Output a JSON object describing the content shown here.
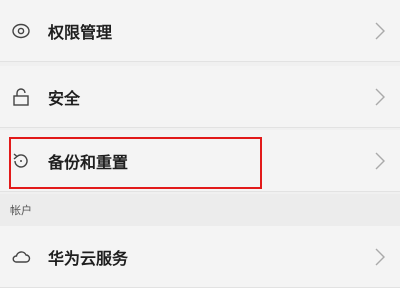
{
  "settings": {
    "items": [
      {
        "label": "权限管理",
        "icon": "fingerprint-icon"
      },
      {
        "label": "安全",
        "icon": "lock-icon"
      },
      {
        "label": "备份和重置",
        "icon": "backup-restore-icon"
      }
    ],
    "account_section": {
      "header": "帐户",
      "items": [
        {
          "label": "华为云服务",
          "icon": "cloud-icon"
        }
      ]
    }
  },
  "colors": {
    "highlight": "#e21a1a",
    "row_background": "#f4f4f4",
    "divider": "#e2e2e2"
  }
}
